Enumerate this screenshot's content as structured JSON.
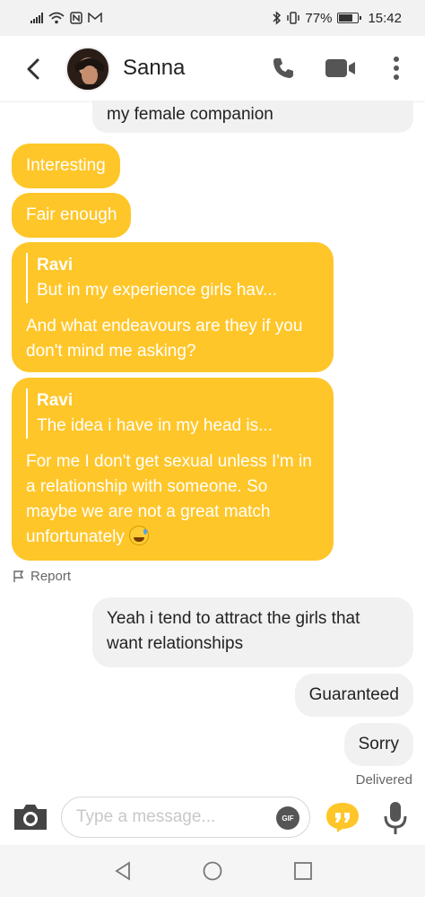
{
  "status_bar": {
    "battery_percent": "77%",
    "battery_level": 0.77,
    "time": "15:42",
    "left_icons": [
      "signal-icon",
      "wifi-icon",
      "nfc-icon",
      "mail-icon"
    ],
    "right_icons": [
      "bluetooth-icon",
      "vibrate-icon",
      "battery-icon"
    ]
  },
  "header": {
    "contact_name": "Sanna",
    "icons": [
      "back-icon",
      "phone-icon",
      "video-call-icon",
      "more-icon"
    ]
  },
  "messages": [
    {
      "from": "me",
      "text": "my female companion"
    },
    {
      "from": "them",
      "text": "Interesting"
    },
    {
      "from": "them",
      "text": "Fair enough"
    },
    {
      "from": "them",
      "quote_name": "Ravi",
      "quote_text": "But in my experience girls hav...",
      "text": "And what endeavours are they if you don't mind me asking?"
    },
    {
      "from": "them",
      "quote_name": "Ravi",
      "quote_text": "The idea i have in my head is...",
      "text": "For me I don't get sexual unless I'm in a relationship with someone. So maybe we are not a great match unfortunately",
      "emoji": "grinning-sweat-emoji"
    },
    {
      "from": "me",
      "text": "Yeah i tend to attract the girls that want relationships"
    },
    {
      "from": "me",
      "text": "Guaranteed"
    },
    {
      "from": "me",
      "text": "Sorry"
    }
  ],
  "report_label": "Report",
  "delivered_label": "Delivered",
  "composer": {
    "placeholder": "Type a message...",
    "gif_label": "GIF",
    "icons": [
      "camera-icon",
      "quote-icon",
      "microphone-icon"
    ]
  },
  "navbar": {
    "icons": [
      "nav-back-icon",
      "nav-home-icon",
      "nav-recents-icon"
    ]
  },
  "colors": {
    "accent": "#ffc629",
    "outgoing_bubble": "#f1f1f1",
    "incoming_text": "#ffffff"
  }
}
